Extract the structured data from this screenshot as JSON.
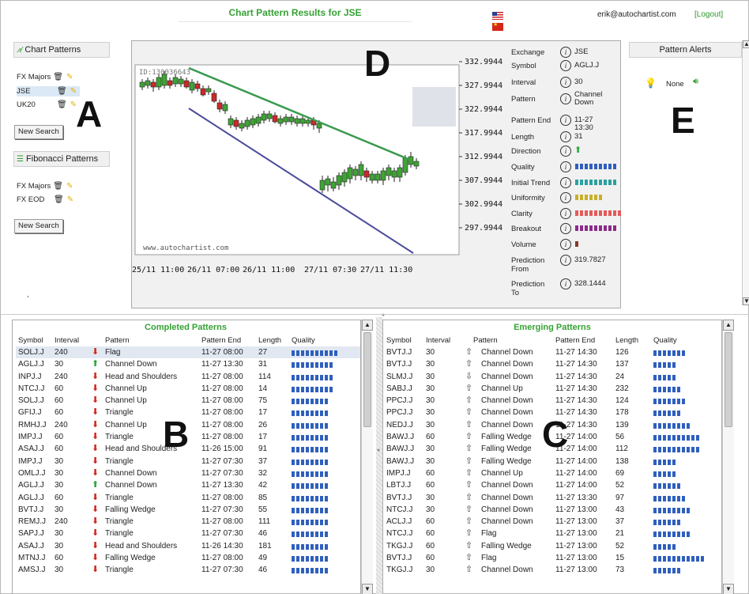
{
  "header": {
    "title": "Chart Pattern Results for JSE",
    "user": "erik@autochartist.com",
    "logout": "[Logout]"
  },
  "sidebar": {
    "chart_patterns_title": "Chart Patterns",
    "chart_watchlists": [
      "FX Majors",
      "JSE",
      "UK20"
    ],
    "new_search": "New Search",
    "fib_patterns_title": "Fibonacci Patterns",
    "fib_watchlists": [
      "FX Majors",
      "FX EOD"
    ],
    "new_search2": "New Search",
    "bullet": ","
  },
  "markers": {
    "a": "A",
    "b": "B",
    "c": "C",
    "d": "D",
    "e": "E"
  },
  "chart": {
    "id_label": "ID:130036643",
    "watermark": "www.autochartist.com",
    "y_ticks": [
      "332.9944",
      "327.9944",
      "322.9944",
      "317.9944",
      "312.9944",
      "307.9944",
      "302.9944",
      "297.9944"
    ],
    "x_ticks": [
      "25/11 11:00",
      "26/11 07:00",
      "26/11 11:00",
      "27/11 07:30",
      "27/11 11:30"
    ],
    "colors": {
      "up": "#3fa535",
      "down": "#cc2a2a",
      "resistance": "#3a9a4f",
      "support": "#4a4a9a"
    }
  },
  "details": {
    "labels": [
      "Exchange",
      "Symbol",
      "Interval",
      "Pattern",
      "Pattern End",
      "Length",
      "Direction",
      "Quality",
      "Initial Trend",
      "Uniformity",
      "Clarity",
      "Breakout",
      "Volume",
      "Prediction From",
      "Prediction To"
    ],
    "exchange": "JSE",
    "symbol": "AGLJ.J",
    "interval": "30",
    "pattern": "Channel Down",
    "pattern_end": "11-27 13:30",
    "length": "31",
    "direction": "up-arrow-icon",
    "quality": 0.9,
    "initial_trend": 0.85,
    "uniformity": 0.6,
    "clarity": 1.0,
    "breakout": 0.9,
    "volume": 0.05,
    "prediction_from": "319.7827",
    "prediction_to": "328.1444",
    "bar_colors": {
      "quality": "#2f5fbd",
      "initial_trend": "#2aa0a0",
      "uniformity": "#c8b02a",
      "clarity": "#e55a5a",
      "breakout": "#8a2a8a",
      "volume": "#8a3a2a"
    }
  },
  "alerts": {
    "title": "Pattern Alerts",
    "value": "None"
  },
  "completed": {
    "title": "Completed Patterns",
    "headers": [
      "Symbol",
      "Interval",
      "Pattern",
      "Pattern End",
      "Length",
      "Quality"
    ],
    "rows": [
      [
        "SOLJ.J",
        "240",
        "d",
        "Flag",
        "11-27 08:00",
        "27",
        10
      ],
      [
        "AGLJ.J",
        "30",
        "u",
        "Channel Down",
        "11-27 13:30",
        "31",
        9
      ],
      [
        "INPJ.J",
        "240",
        "d",
        "Head and Shoulders",
        "11-27 08:00",
        "114",
        9
      ],
      [
        "NTCJ.J",
        "60",
        "d",
        "Channel Up",
        "11-27 08:00",
        "14",
        9
      ],
      [
        "SOLJ.J",
        "60",
        "d",
        "Channel Up",
        "11-27 08:00",
        "75",
        8
      ],
      [
        "GFIJ.J",
        "60",
        "d",
        "Triangle",
        "11-27 08:00",
        "17",
        8
      ],
      [
        "RMHJ.J",
        "240",
        "d",
        "Channel Up",
        "11-27 08:00",
        "26",
        8
      ],
      [
        "IMPJ.J",
        "60",
        "d",
        "Triangle",
        "11-27 08:00",
        "17",
        8
      ],
      [
        "ASAJ.J",
        "60",
        "d",
        "Head and Shoulders",
        "11-26 15:00",
        "91",
        8
      ],
      [
        "IMPJ.J",
        "30",
        "d",
        "Triangle",
        "11-27 07:30",
        "37",
        8
      ],
      [
        "OMLJ.J",
        "30",
        "d",
        "Channel Down",
        "11-27 07:30",
        "32",
        8
      ],
      [
        "AGLJ.J",
        "30",
        "u",
        "Channel Down",
        "11-27 13:30",
        "42",
        8
      ],
      [
        "AGLJ.J",
        "60",
        "d",
        "Triangle",
        "11-27 08:00",
        "85",
        8
      ],
      [
        "BVTJ.J",
        "30",
        "d",
        "Falling Wedge",
        "11-27 07:30",
        "55",
        8
      ],
      [
        "REMJ.J",
        "240",
        "d",
        "Triangle",
        "11-27 08:00",
        "111",
        8
      ],
      [
        "SAPJ.J",
        "30",
        "d",
        "Triangle",
        "11-27 07:30",
        "46",
        8
      ],
      [
        "ASAJ.J",
        "30",
        "d",
        "Head and Shoulders",
        "11-26 14:30",
        "181",
        8
      ],
      [
        "MTNJ.J",
        "60",
        "d",
        "Falling Wedge",
        "11-27 08:00",
        "49",
        8
      ],
      [
        "AMSJ.J",
        "30",
        "d",
        "Triangle",
        "11-27 07:30",
        "46",
        8
      ]
    ]
  },
  "emerging": {
    "title": "Emerging Patterns",
    "headers": [
      "Symbol",
      "Interval",
      "Pattern",
      "Pattern End",
      "Length",
      "Quality"
    ],
    "rows": [
      [
        "BVTJ.J",
        "30",
        "o",
        "Channel Down",
        "11-27 14:30",
        "126",
        7
      ],
      [
        "BVTJ.J",
        "30",
        "o",
        "Channel Down",
        "11-27 14:30",
        "137",
        5
      ],
      [
        "SLMJ.J",
        "30",
        "od",
        "Channel Down",
        "11-27 14:30",
        "24",
        5
      ],
      [
        "SABJ.J",
        "30",
        "o",
        "Channel Up",
        "11-27 14:30",
        "232",
        6
      ],
      [
        "PPCJ.J",
        "30",
        "o",
        "Channel Down",
        "11-27 14:30",
        "124",
        7
      ],
      [
        "PPCJ.J",
        "30",
        "o",
        "Channel Down",
        "11-27 14:30",
        "178",
        6
      ],
      [
        "NEDJ.J",
        "30",
        "o",
        "Channel Down",
        "11-27 14:30",
        "139",
        8
      ],
      [
        "BAWJ.J",
        "60",
        "o",
        "Falling Wedge",
        "11-27 14:00",
        "56",
        10
      ],
      [
        "BAWJ.J",
        "30",
        "o",
        "Falling Wedge",
        "11-27 14:00",
        "112",
        10
      ],
      [
        "BAWJ.J",
        "30",
        "o",
        "Falling Wedge",
        "11-27 14:00",
        "138",
        5
      ],
      [
        "IMPJ.J",
        "60",
        "o",
        "Channel Up",
        "11-27 14:00",
        "69",
        5
      ],
      [
        "LBTJ.J",
        "60",
        "o",
        "Channel Down",
        "11-27 14:00",
        "52",
        6
      ],
      [
        "BVTJ.J",
        "30",
        "o",
        "Channel Down",
        "11-27 13:30",
        "97",
        7
      ],
      [
        "NTCJ.J",
        "30",
        "o",
        "Channel Down",
        "11-27 13:00",
        "43",
        8
      ],
      [
        "ACLJ.J",
        "60",
        "o",
        "Channel Down",
        "11-27 13:00",
        "37",
        6
      ],
      [
        "NTCJ.J",
        "60",
        "o",
        "Flag",
        "11-27 13:00",
        "21",
        8
      ],
      [
        "TKGJ.J",
        "60",
        "o",
        "Falling Wedge",
        "11-27 13:00",
        "52",
        5
      ],
      [
        "BVTJ.J",
        "60",
        "o",
        "Flag",
        "11-27 13:00",
        "15",
        11
      ],
      [
        "TKGJ.J",
        "30",
        "o",
        "Channel Down",
        "11-27 13:00",
        "73",
        6
      ]
    ]
  }
}
